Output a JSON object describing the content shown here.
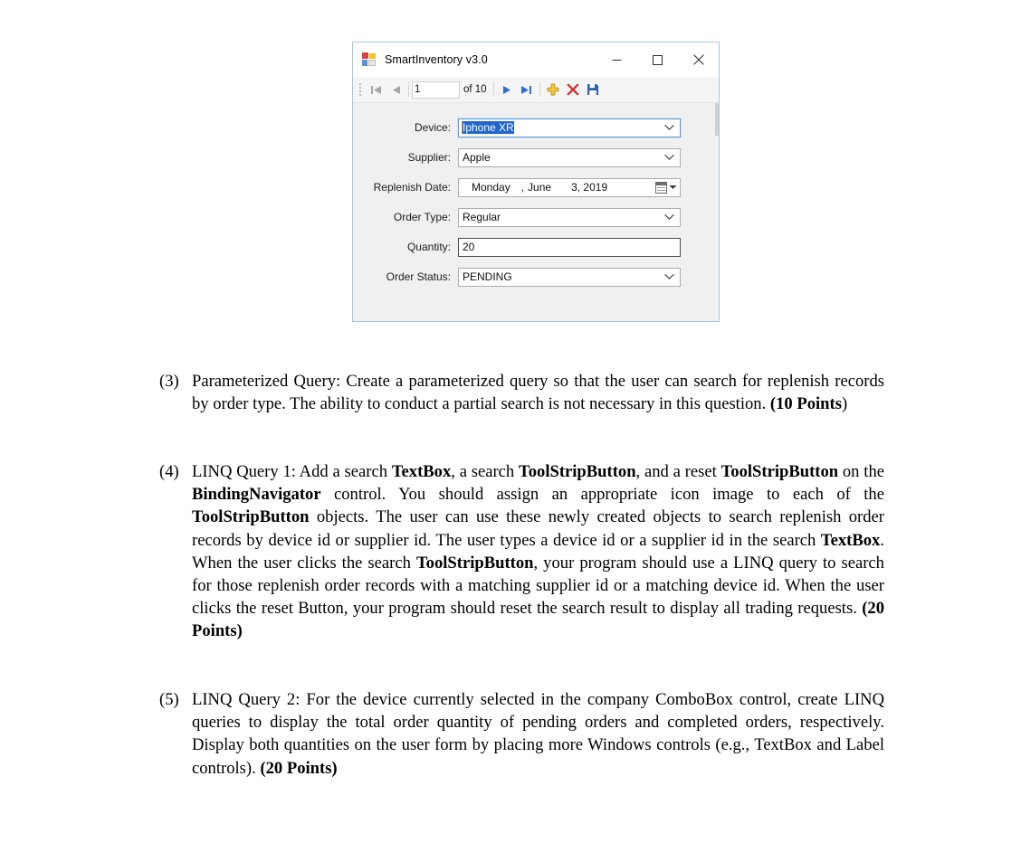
{
  "app": {
    "title": "SmartInventory v3.0",
    "icon": "winforms-app-icon",
    "window_buttons": {
      "minimize": "minimize-icon",
      "maximize": "maximize-icon",
      "close": "close-icon"
    },
    "toolbar": {
      "move_first_label": "move-first-icon",
      "move_previous_label": "move-previous-icon",
      "position_value": "1",
      "count_label": "of 10",
      "move_next_label": "move-next-icon",
      "move_last_label": "move-last-icon",
      "add_label": "add-new-icon",
      "delete_label": "delete-icon",
      "save_label": "save-icon"
    },
    "fields": [
      {
        "label": "Device:",
        "value": "Iphone XR",
        "type": "combobox",
        "focused": true
      },
      {
        "label": "Supplier:",
        "value": "Apple",
        "type": "combobox",
        "focused": false
      },
      {
        "label": "Replenish Date:",
        "value": "Monday , June 3, 2019",
        "type": "datepicker",
        "focused": false
      },
      {
        "label": "Order Type:",
        "value": "Regular",
        "type": "combobox",
        "focused": false
      },
      {
        "label": "Quantity:",
        "value": "20",
        "type": "textbox",
        "focused": false
      },
      {
        "label": "Order Status:",
        "value": "PENDING",
        "type": "combobox",
        "focused": false
      }
    ],
    "date_parts": {
      "weekday": "Monday",
      "comma": ",",
      "month": "June",
      "day_year": "3, 2019"
    }
  },
  "document": {
    "items": [
      {
        "number": "(3)",
        "lines": [
          {
            "runs": [
              {
                "text": "Parameterized Query: Create a parameterized query so that the user can search for replenish records by order type. The ability to conduct a partial search is not necessary in this question. ",
                "bold": false
              },
              {
                "text": "(10 Points",
                "bold": true
              },
              {
                "text": ")",
                "bold": false
              }
            ]
          }
        ]
      },
      {
        "number": "(4)",
        "lines": [
          {
            "runs": [
              {
                "text": "LINQ Query 1: Add a search ",
                "bold": false
              },
              {
                "text": "TextBox",
                "bold": true
              },
              {
                "text": ", a search ",
                "bold": false
              },
              {
                "text": "ToolStripButton",
                "bold": true
              },
              {
                "text": ", and a reset ",
                "bold": false
              },
              {
                "text": "ToolStripButton",
                "bold": true
              },
              {
                "text": " on the ",
                "bold": false
              },
              {
                "text": "BindingNavigator",
                "bold": true
              },
              {
                "text": " control. You should assign an appropriate icon image to each of the ",
                "bold": false
              },
              {
                "text": "ToolStripButton",
                "bold": true
              },
              {
                "text": " objects. The user can use these newly created objects to search replenish order records by device id or supplier id. The user types a device id or a supplier id in the search ",
                "bold": false
              },
              {
                "text": "TextBox",
                "bold": true
              },
              {
                "text": ". When the user clicks the search ",
                "bold": false
              },
              {
                "text": "ToolStripButton",
                "bold": true
              },
              {
                "text": ", your program should use a LINQ query to search  for those replenish order records with a matching supplier id or a matching device id. When the user clicks the reset Button, your program should reset the search result to display all trading requests. ",
                "bold": false
              },
              {
                "text": "(20 Points)",
                "bold": true
              }
            ]
          }
        ]
      },
      {
        "number": "(5)",
        "lines": [
          {
            "runs": [
              {
                "text": "LINQ Query 2: For the device currently selected in the company ComboBox control, create LINQ queries to display the total order quantity of pending orders and completed orders, respectively. Display both quantities on the user form by placing more Windows controls (e.g., TextBox and Label controls). ",
                "bold": false
              },
              {
                "text": "(20 Points)",
                "bold": true
              }
            ]
          }
        ]
      }
    ]
  },
  "colors": {
    "window_border": "#9ec7e8",
    "form_background": "#f0f0f0",
    "selection_blue": "#2266cc",
    "add_icon": "#f0c419",
    "delete_icon": "#d62f2f",
    "save_icon": "#2d63ad",
    "nav_arrow_enabled": "#2f6fd0",
    "nav_arrow_disabled": "#a6a6a6"
  }
}
